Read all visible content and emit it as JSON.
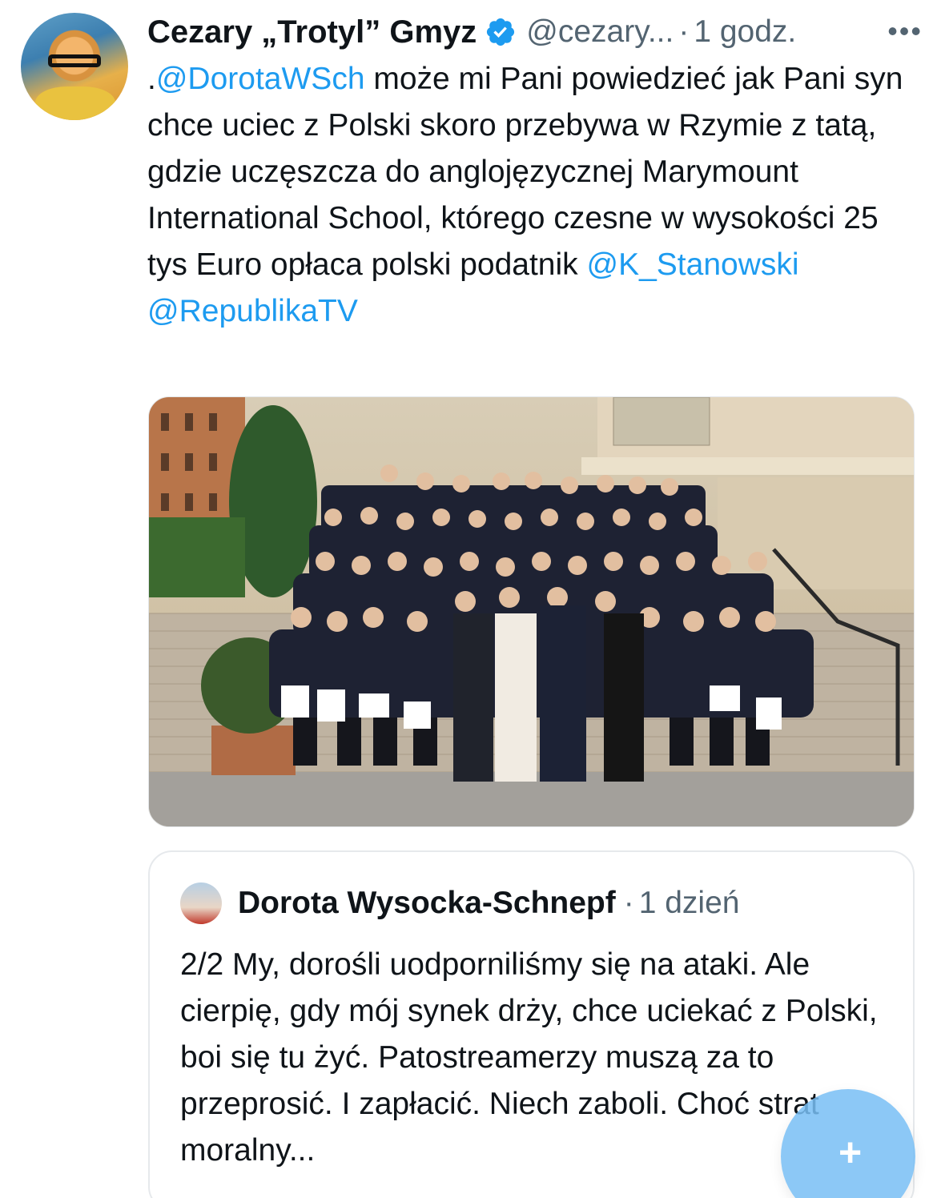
{
  "tweet": {
    "author": {
      "display_name": "Cezary „Trotyl” Gmyz",
      "handle": "@cezary...",
      "verified": true,
      "verified_color": "#1d9bf0"
    },
    "time_separator": "·",
    "time": "1 godz.",
    "more_icon": "more-horizontal-icon",
    "body": {
      "lead": ".",
      "mention1": "@DorotaWSch",
      "text": " może mi Pani powiedzieć jak Pani syn chce uciec z Polski skoro przebywa  w Rzymie z tatą, gdzie uczęszcza do anglojęzycznej Marymount International School, którego czesne w wysokości 25 tys Euro opłaca polski podatnik ",
      "mention2": "@K_Stanowski",
      "mention3": "@RepublikaTV"
    },
    "media": {
      "kind": "photo",
      "icon": "group-photo"
    }
  },
  "quote": {
    "display_name": "Dorota Wysocka-Schnepf",
    "time_separator": "·",
    "time": "1 dzień",
    "text": "2/2 My, dorośli uodporniliśmy się na ataki. Ale cierpię, gdy mój synek drży, chce uciekać z Polski, boi się tu żyć. Patostreamerzy muszą za to przeprosić. I zapłacić. Niech zaboli. Choć strat moralny..."
  },
  "compose_button": {
    "icon": "compose-plus-icon",
    "symbol": "+",
    "color": "#1d9bf0"
  },
  "colors": {
    "text": "#0f1419",
    "secondary": "#536471",
    "link": "#1d9bf0",
    "border": "#e6e9ec"
  }
}
